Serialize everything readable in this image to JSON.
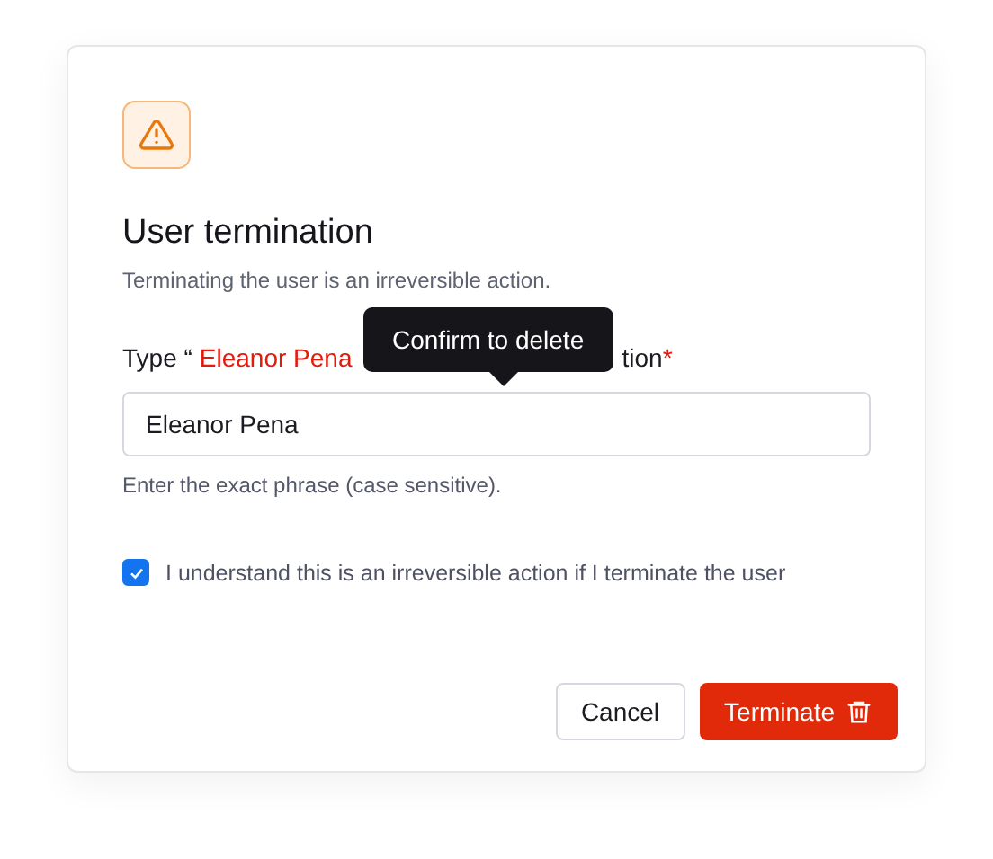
{
  "dialog": {
    "title": "User termination",
    "subtitle": "Terminating the user is an irreversible action.",
    "field": {
      "label_prefix": "Type “",
      "label_name": "Eleanor Pena",
      "label_suffix": "tion",
      "required_mark": "*",
      "value": "Eleanor Pena",
      "hint": "Enter the exact phrase (case sensitive)."
    },
    "tooltip": "Confirm to delete",
    "confirm": {
      "label": "I understand this is an irreversible action if I terminate the user",
      "checked": true
    },
    "buttons": [
      {
        "kind": "secondary",
        "label": "Cancel"
      },
      {
        "kind": "danger",
        "label": "Terminate"
      }
    ]
  }
}
